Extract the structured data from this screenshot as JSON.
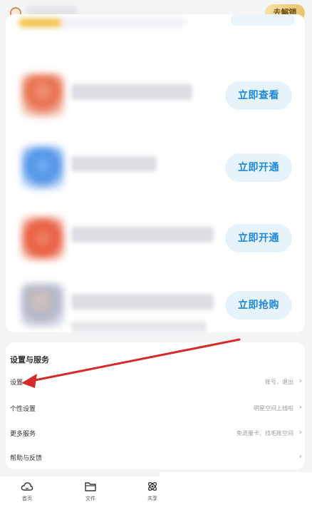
{
  "header": {
    "unlock_label": "去解锁"
  },
  "promo": {
    "items": [
      {
        "button_label": "立即查看",
        "thumb_color": "#e86a4a"
      },
      {
        "button_label": "立即开通",
        "thumb_color": "#4a8fe8"
      },
      {
        "button_label": "立即开通",
        "thumb_color": "#e8563a"
      },
      {
        "button_label": "立即抢购",
        "thumb_color": "#b0b6c8"
      }
    ]
  },
  "settings": {
    "title": "设置与服务",
    "rows": [
      {
        "label": "设置",
        "value": "账号、退出"
      },
      {
        "label": "个性设置",
        "value": "明星空间上线啦"
      },
      {
        "label": "更多服务",
        "value": "免流量卡、找毛账空间"
      },
      {
        "label": "帮助与反馈",
        "value": ""
      }
    ]
  },
  "nav": {
    "items": [
      {
        "label": "首页",
        "icon": "home-cloud-icon"
      },
      {
        "label": "文件",
        "icon": "folder-icon"
      },
      {
        "label": "共享",
        "icon": "share-atom-icon"
      }
    ]
  },
  "colors": {
    "accent": "#1e88d8",
    "promo_button_bg": "#e7f3fb",
    "annotation_arrow": "#d62b2b",
    "unlock_button": "#e9c56a"
  }
}
